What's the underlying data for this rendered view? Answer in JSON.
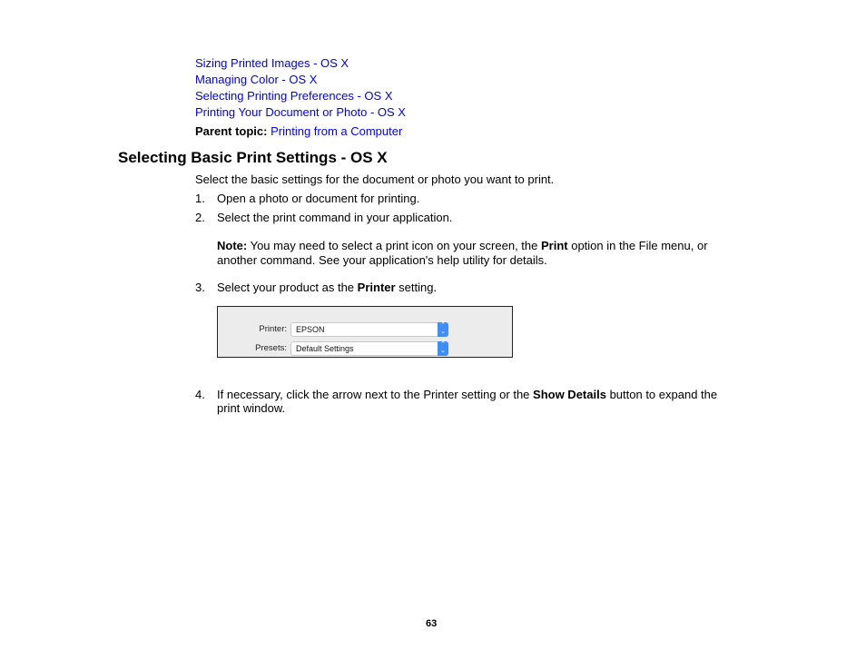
{
  "related_links": [
    "Sizing Printed Images - OS X",
    "Managing Color - OS X",
    "Selecting Printing Preferences - OS X",
    "Printing Your Document or Photo - OS X"
  ],
  "parent_topic": {
    "label": "Parent topic:",
    "link": "Printing from a Computer"
  },
  "section": {
    "title": "Selecting Basic Print Settings - OS X",
    "intro": "Select the basic settings for the document or photo you want to print.",
    "steps": [
      {
        "num": "1.",
        "text": "Open a photo or document for printing."
      },
      {
        "num": "2.",
        "text": "Select the print command in your application."
      },
      {
        "num": "3.",
        "text_before": "Select your product as the ",
        "bold": "Printer",
        "text_after": " setting."
      },
      {
        "num": "4.",
        "text_before": "If necessary, click the arrow next to the Printer setting or the ",
        "bold": "Show Details",
        "text_after": " button to expand the print window."
      }
    ],
    "note": {
      "label": "Note:",
      "text_before": " You may need to select a print icon on your screen, the ",
      "bold": "Print",
      "text_after": " option in the File menu, or another command. See your application's help utility for details."
    }
  },
  "print_dialog": {
    "printer_label": "Printer:",
    "printer_value": "EPSON",
    "presets_label": "Presets:",
    "presets_value": "Default Settings",
    "stepper_up": "⌃",
    "stepper_down": "⌄",
    "accent_color": "#3d8ef5"
  },
  "page_number": "63"
}
